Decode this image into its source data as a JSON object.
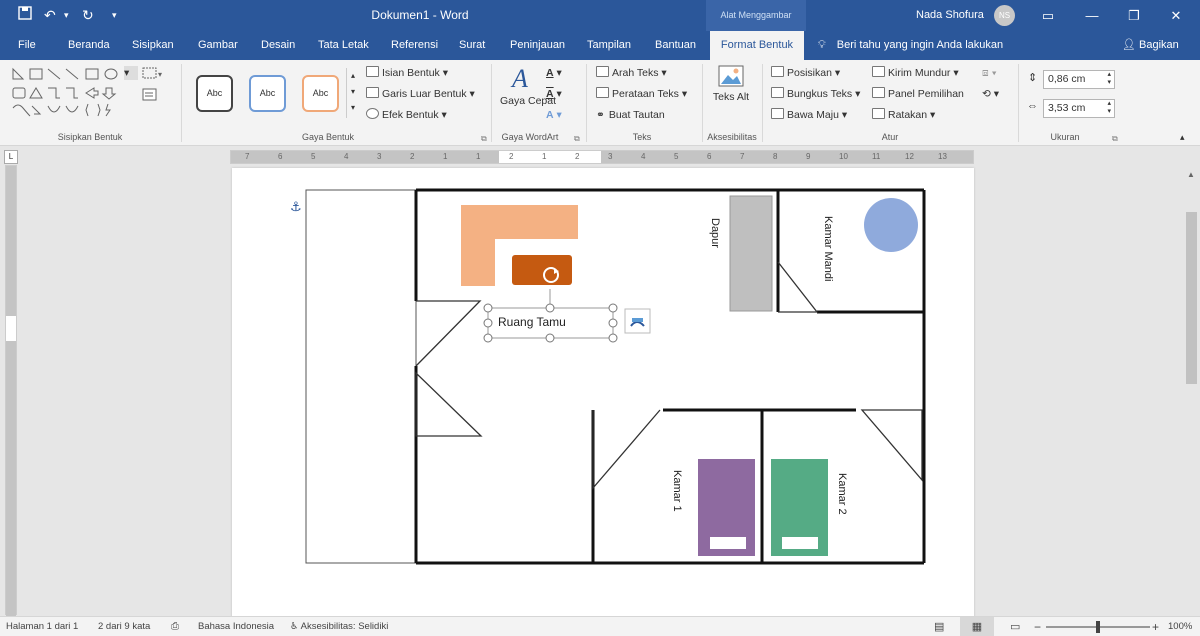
{
  "titlebar": {
    "doc_title": "Dokumen1 - Word",
    "context_tools": "Alat Menggambar",
    "user_name": "Nada Shofura",
    "user_initials": "NS",
    "save_icon": "save-icon",
    "undo_icon": "undo-icon",
    "redo_icon": "redo-icon",
    "customize_icon": "chevron-down-icon"
  },
  "tabs": [
    {
      "label": "File"
    },
    {
      "label": "Beranda"
    },
    {
      "label": "Sisipkan"
    },
    {
      "label": "Gambar"
    },
    {
      "label": "Desain"
    },
    {
      "label": "Tata Letak"
    },
    {
      "label": "Referensi"
    },
    {
      "label": "Surat"
    },
    {
      "label": "Peninjauan"
    },
    {
      "label": "Tampilan"
    },
    {
      "label": "Bantuan"
    },
    {
      "label": "Format Bentuk",
      "active": true
    }
  ],
  "tell_me": "Beri tahu yang ingin Anda lakukan",
  "share_label": "Bagikan",
  "ribbon": {
    "groups": {
      "insert_shapes": "Sisipkan Bentuk",
      "shape_styles": "Gaya Bentuk",
      "wordart_styles": "Gaya WordArt",
      "text": "Teks",
      "accessibility": "Aksesibilitas",
      "arrange": "Atur",
      "size": "Ukuran"
    },
    "style_sample": "Abc",
    "shape_fill": "Isian Bentuk",
    "shape_outline": "Garis Luar Bentuk",
    "shape_effects": "Efek Bentuk",
    "quick_styles": "Gaya Cepat",
    "text_direction": "Arah Teks",
    "align_text": "Perataan Teks",
    "create_link": "Buat Tautan",
    "alt_text": "Teks Alt",
    "position": "Posisikan",
    "wrap_text": "Bungkus Teks",
    "bring_forward": "Bawa Maju",
    "send_backward": "Kirim Mundur",
    "selection_pane": "Panel Pemilihan",
    "align": "Ratakan",
    "height_value": "0,86 cm",
    "width_value": "3,53 cm"
  },
  "ruler": {
    "labels": [
      "7",
      "6",
      "5",
      "4",
      "3",
      "2",
      "1",
      "1",
      "2",
      "1",
      "2",
      "3",
      "4",
      "5",
      "6",
      "7",
      "8",
      "9",
      "10",
      "11",
      "12",
      "13"
    ]
  },
  "document": {
    "rooms": {
      "living": "Ruang Tamu",
      "kitchen": "Dapur",
      "bathroom": "Kamar Mandi",
      "bedroom1": "Kamar 1",
      "bedroom2": "Kamar 2"
    },
    "colors": {
      "sofa": "#f4b183",
      "table": "#c55a11",
      "kitchen_counter": "#bfbfbf",
      "bath": "#8faadc",
      "bed1": "#8e6aa0",
      "bed2": "#55ab85"
    }
  },
  "status": {
    "page": "Halaman 1 dari 1",
    "words": "2 dari 9 kata",
    "language": "Bahasa Indonesia",
    "accessibility": "Aksesibilitas: Selidiki",
    "zoom": "100%"
  }
}
